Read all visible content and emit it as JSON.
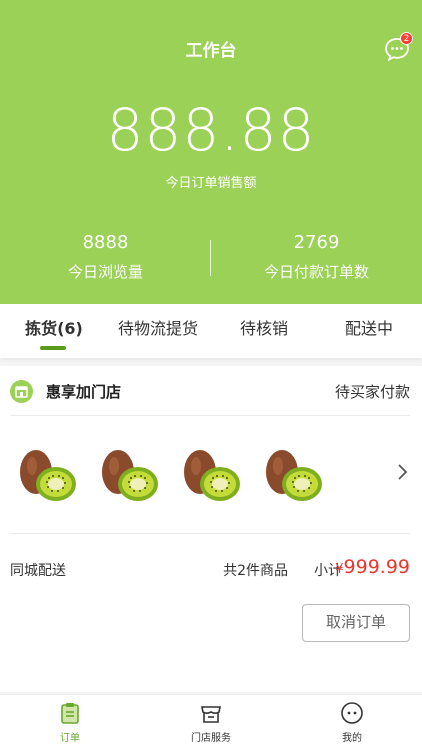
{
  "header": {
    "title": "工作台",
    "message_badge": "2",
    "sales_amount": "888.88",
    "sales_label": "今日订单销售额",
    "stats": [
      {
        "value": "8888",
        "label": "今日浏览量"
      },
      {
        "value": "2769",
        "label": "今日付款订单数"
      }
    ]
  },
  "tabs": [
    {
      "label": "拣货(6)"
    },
    {
      "label": "待物流提货"
    },
    {
      "label": "待核销"
    },
    {
      "label": "配送中"
    }
  ],
  "order": {
    "store_name": "惠享加门店",
    "status": "待买家付款",
    "delivery_type": "同城配送",
    "item_count": "共2件商品",
    "subtotal_label": "小计",
    "currency": "¥",
    "subtotal": "999.99",
    "cancel_label": "取消订单",
    "product_count_shown": 4
  },
  "bottom_nav": [
    {
      "label": "订单",
      "icon": "clipboard-icon"
    },
    {
      "label": "门店服务",
      "icon": "store-icon"
    },
    {
      "label": "我的",
      "icon": "face-icon"
    }
  ],
  "colors": {
    "primary_green": "#9bd156",
    "active_green": "#6aa82e",
    "price_red": "#e8372e"
  }
}
